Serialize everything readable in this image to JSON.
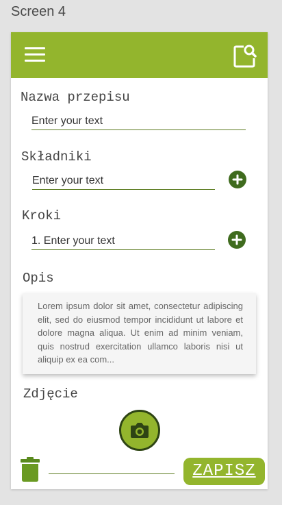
{
  "screen_label": "Screen 4",
  "appbar": {
    "menu_icon": "hamburger-menu-icon",
    "action_icon": "document-search-icon",
    "color": "#93b52d"
  },
  "form": {
    "name": {
      "label": "Nazwa przepisu",
      "placeholder": "Enter your text"
    },
    "ingredients": {
      "label": "Składniki",
      "placeholder": "Enter your text",
      "add_icon": "plus-circle-icon"
    },
    "steps": {
      "label": "Kroki",
      "placeholder": "1. Enter your text",
      "add_icon": "plus-circle-icon"
    },
    "description": {
      "label": "Opis",
      "text": "Lorem ipsum dolor sit amet, consectetur adipiscing elit, sed do eiusmod tempor incididunt ut labore et dolore magna aliqua. Ut enim ad minim veniam, quis nostrud exercitation ullamco laboris nisi ut aliquip ex ea com..."
    },
    "photo": {
      "label": "Zdjęcie",
      "icon": "camera-icon"
    }
  },
  "footer": {
    "delete_icon": "trash-icon",
    "save_label": "ZAPISZ"
  }
}
